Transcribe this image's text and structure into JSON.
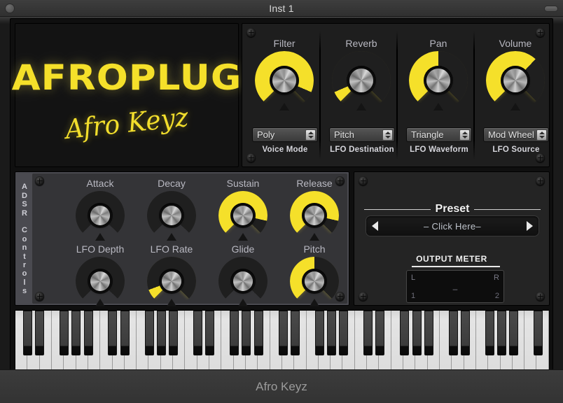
{
  "titlebar": {
    "title": "Inst 1"
  },
  "branding": {
    "logo": "AFROPLUG",
    "sublogo": "Afro Keyz"
  },
  "top_section": {
    "knobs": [
      {
        "label": "Filter",
        "value": 92
      },
      {
        "label": "Reverb",
        "value": 8
      },
      {
        "label": "Pan",
        "value": 50
      },
      {
        "label": "Volume",
        "value": 66
      }
    ],
    "selectors": [
      {
        "value": "Poly",
        "caption": "Voice Mode"
      },
      {
        "value": "Pitch",
        "caption": "LFO Destination"
      },
      {
        "value": "Triangle",
        "caption": "LFO Waveform"
      },
      {
        "value": "Mod Wheel",
        "caption": "LFO Source"
      }
    ]
  },
  "adsr_section": {
    "vertical_label": "ADSR Controls",
    "knobs": [
      {
        "label": "Attack",
        "value": 0
      },
      {
        "label": "Decay",
        "value": 0
      },
      {
        "label": "Sustain",
        "value": 88
      },
      {
        "label": "Release",
        "value": 88
      },
      {
        "label": "LFO Depth",
        "value": 0
      },
      {
        "label": "LFO Rate",
        "value": 9
      },
      {
        "label": "Glide",
        "value": 0
      },
      {
        "label": "Pitch",
        "value": 50
      }
    ]
  },
  "right_section": {
    "preset_title": "Preset",
    "preset_value": "– Click Here–",
    "prev_icon": "left-triangle-icon",
    "next_icon": "right-triangle-icon",
    "meter_title": "OUTPUT METER",
    "meter_left": "L",
    "meter_right": "R",
    "meter_ch1": "1",
    "meter_ch2": "2",
    "meter_dash": "–"
  },
  "footer": {
    "label": "Afro Keyz"
  },
  "colors": {
    "accent": "#f5e02a",
    "panel": "#1e1e1e",
    "adsr_panel": "#343437"
  }
}
